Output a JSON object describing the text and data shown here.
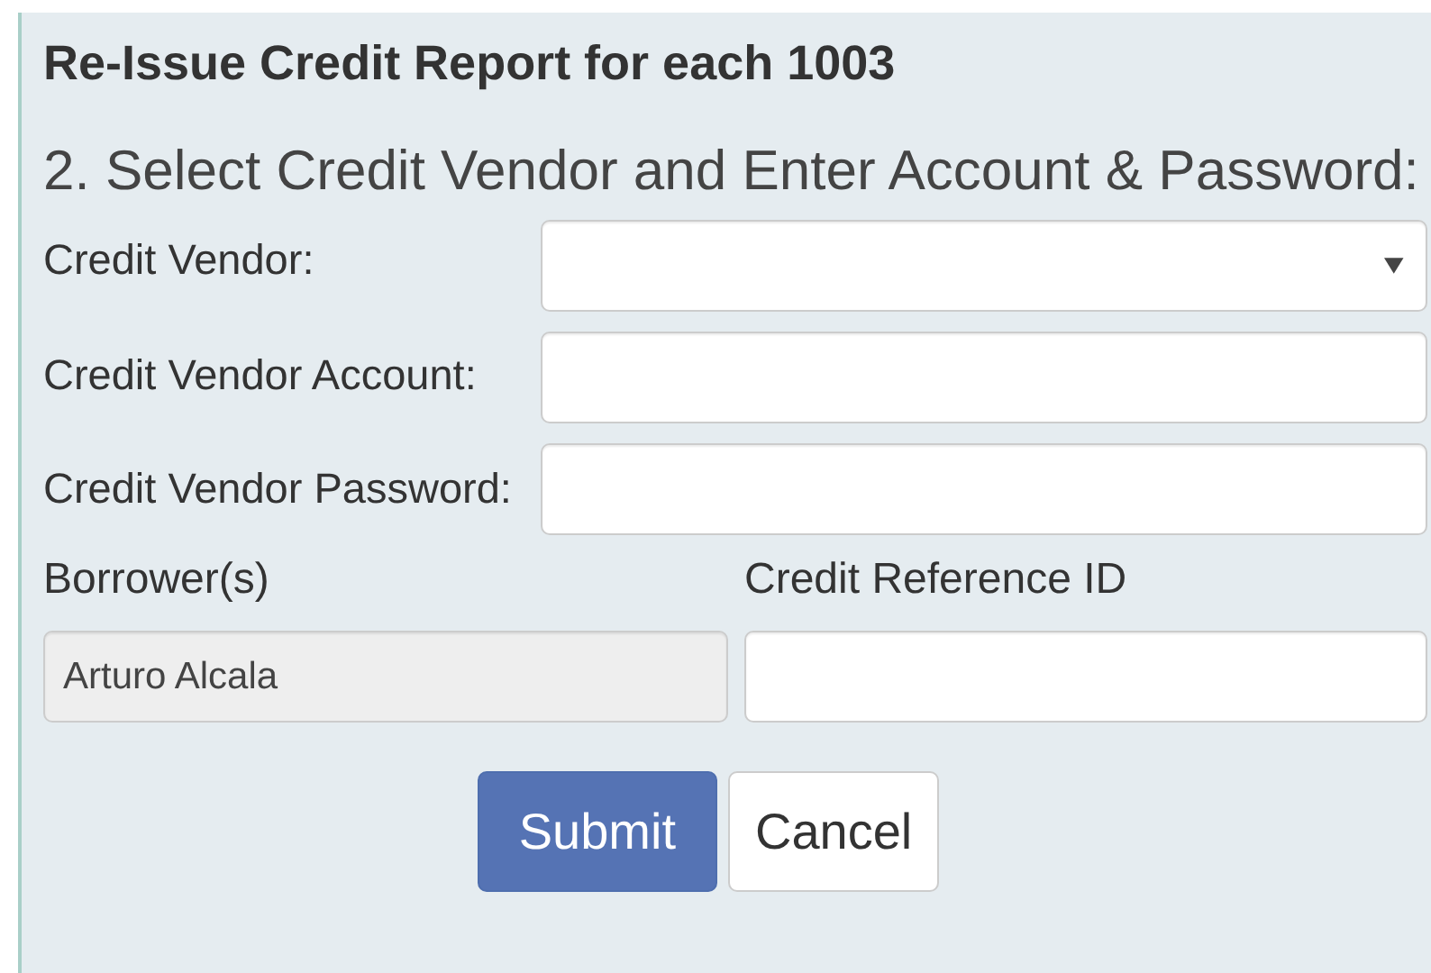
{
  "title": "Re-Issue Credit Report for each 1003",
  "step": "2. Select Credit Vendor and Enter Account & Password:",
  "fields": [
    {
      "kind": "select",
      "label": "Credit Vendor:"
    },
    {
      "kind": "text",
      "label": "Credit Vendor Account:"
    },
    {
      "kind": "password",
      "label": "Credit Vendor Password:"
    }
  ],
  "borrower": {
    "label": "Borrower(s)",
    "value": "Arturo Alcala",
    "disabled": true
  },
  "reference": {
    "label": "Credit Reference ID"
  },
  "buttons": [
    {
      "label": "Submit",
      "kind": "primary"
    },
    {
      "label": "Cancel",
      "kind": "default"
    }
  ]
}
